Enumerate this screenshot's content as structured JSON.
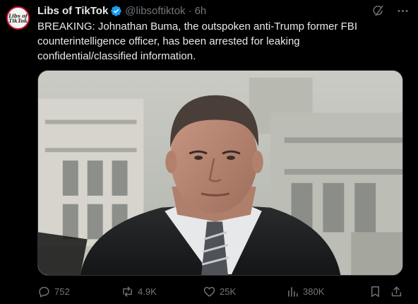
{
  "account": {
    "avatar_text": "Libs of\nTikTok",
    "display_name": "Libs of TikTok",
    "handle": "@libsoftiktok",
    "separator": "·",
    "time": "6h"
  },
  "post": {
    "text": "BREAKING: Johnathan Buma, the outspoken anti-Trump former FBI counterintelligence officer, has been arrested for leaking confidential/classified information."
  },
  "media": {
    "watermark": ""
  },
  "actions": {
    "replies": "752",
    "reposts": "4.9K",
    "likes": "25K",
    "views": "380K"
  },
  "icons": {
    "verified": "verified-badge-icon",
    "grok": "grok-icon",
    "more": "more-icon",
    "reply": "reply-icon",
    "repost": "repost-icon",
    "like": "like-icon",
    "views": "views-icon",
    "bookmark": "bookmark-icon",
    "share": "share-icon"
  },
  "colors": {
    "background": "#000000",
    "text": "#e7e9ea",
    "muted": "#71767b",
    "verified": "#1d9bf0",
    "avatar_ring": "#c8143c"
  }
}
